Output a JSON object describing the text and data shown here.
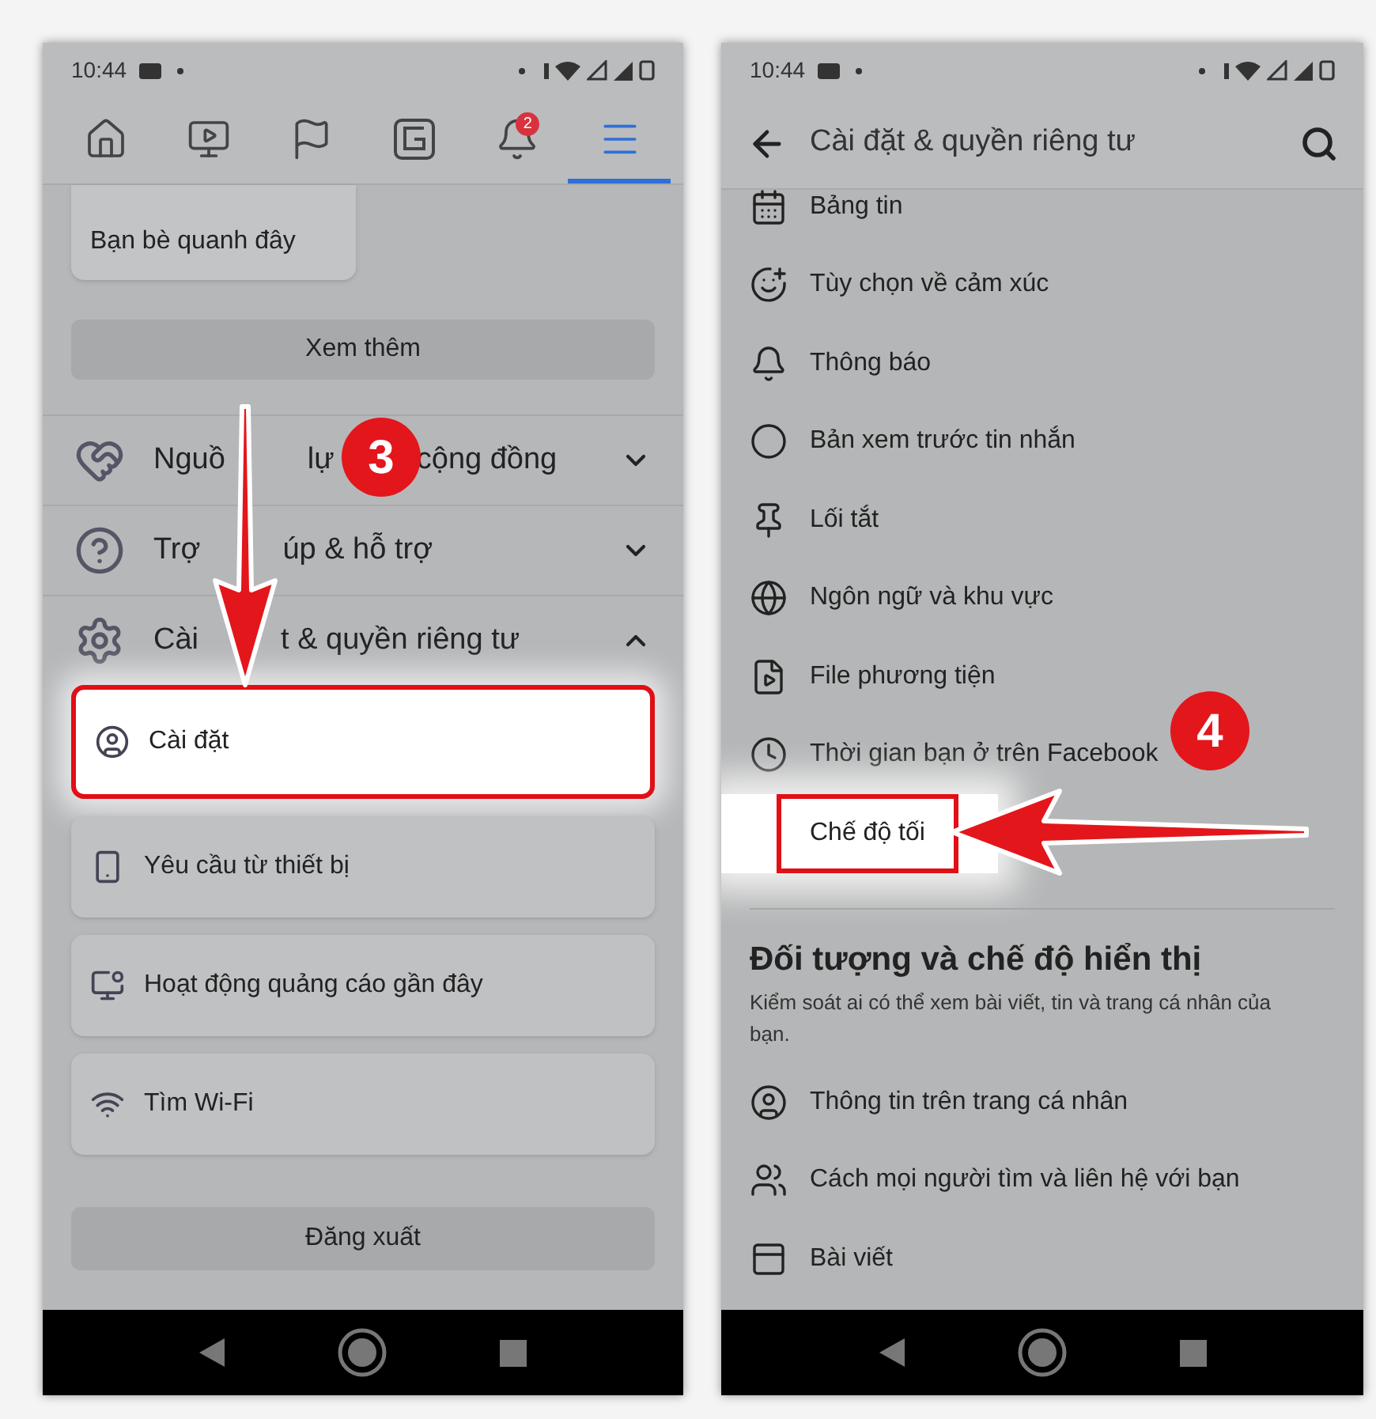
{
  "left_screen": {
    "status_bar": {
      "time": "10:44"
    },
    "tabs": [
      {
        "kind": "home",
        "selected": false
      },
      {
        "kind": "video",
        "selected": false
      },
      {
        "kind": "flag",
        "selected": false
      },
      {
        "kind": "gaming",
        "selected": false
      },
      {
        "kind": "bell",
        "selected": false,
        "badge": "2"
      },
      {
        "kind": "menu",
        "selected": true
      }
    ],
    "shortcut_card": {
      "label": "Bạn bè quanh đây"
    },
    "see_more_button": "Xem thêm",
    "sections": [
      {
        "kind": "community",
        "label_parts": [
          "Nguồ",
          "lự",
          "cộng đồng"
        ],
        "expanded": false
      },
      {
        "kind": "help",
        "label_parts": [
          "Trợ",
          "úp & hỗ trợ"
        ],
        "expanded": false
      },
      {
        "kind": "settings",
        "label_parts": [
          "Cài",
          "t & quyền riêng tư"
        ],
        "expanded": true
      }
    ],
    "settings_items": [
      {
        "kind": "profile",
        "label": "Cài đặt",
        "highlighted": true
      },
      {
        "kind": "device",
        "label": "Yêu cầu từ thiết bị",
        "highlighted": false
      },
      {
        "kind": "ads",
        "label": "Hoạt động quảng cáo gần đây",
        "highlighted": false
      },
      {
        "kind": "wifi",
        "label": "Tìm Wi-Fi",
        "highlighted": false
      }
    ],
    "logout_button": "Đăng xuất",
    "step_badge": "3"
  },
  "right_screen": {
    "status_bar": {
      "time": "10:44"
    },
    "header": {
      "title": "Cài đặt & quyền riêng tư"
    },
    "items": [
      {
        "kind": "feed",
        "label": "Bảng tin",
        "highlighted": false
      },
      {
        "kind": "reactions",
        "label": "Tùy chọn về cảm xúc",
        "highlighted": false
      },
      {
        "kind": "bell",
        "label": "Thông báo",
        "highlighted": false
      },
      {
        "kind": "preview",
        "label": "Bản xem trước tin nhắn",
        "highlighted": false
      },
      {
        "kind": "pin",
        "label": "Lối tắt",
        "highlighted": false
      },
      {
        "kind": "globe",
        "label": "Ngôn ngữ và khu vực",
        "highlighted": false
      },
      {
        "kind": "media",
        "label": "File phương tiện",
        "highlighted": false
      },
      {
        "kind": "clock",
        "label": "Thời gian bạn ở trên Facebook",
        "highlighted": false
      },
      {
        "kind": "none",
        "label": "Chế độ tối",
        "highlighted": true
      }
    ],
    "section": {
      "title": "Đối tượng và chế độ hiển thị",
      "description": "Kiểm soát ai có thể xem bài viết, tin và trang cá nhân của bạn."
    },
    "section_items": [
      {
        "kind": "profile",
        "label": "Thông tin trên trang cá nhân"
      },
      {
        "kind": "people",
        "label": "Cách mọi người tìm và liên hệ với bạn"
      },
      {
        "kind": "posts",
        "label": "Bài viết"
      }
    ],
    "step_badge": "4"
  }
}
